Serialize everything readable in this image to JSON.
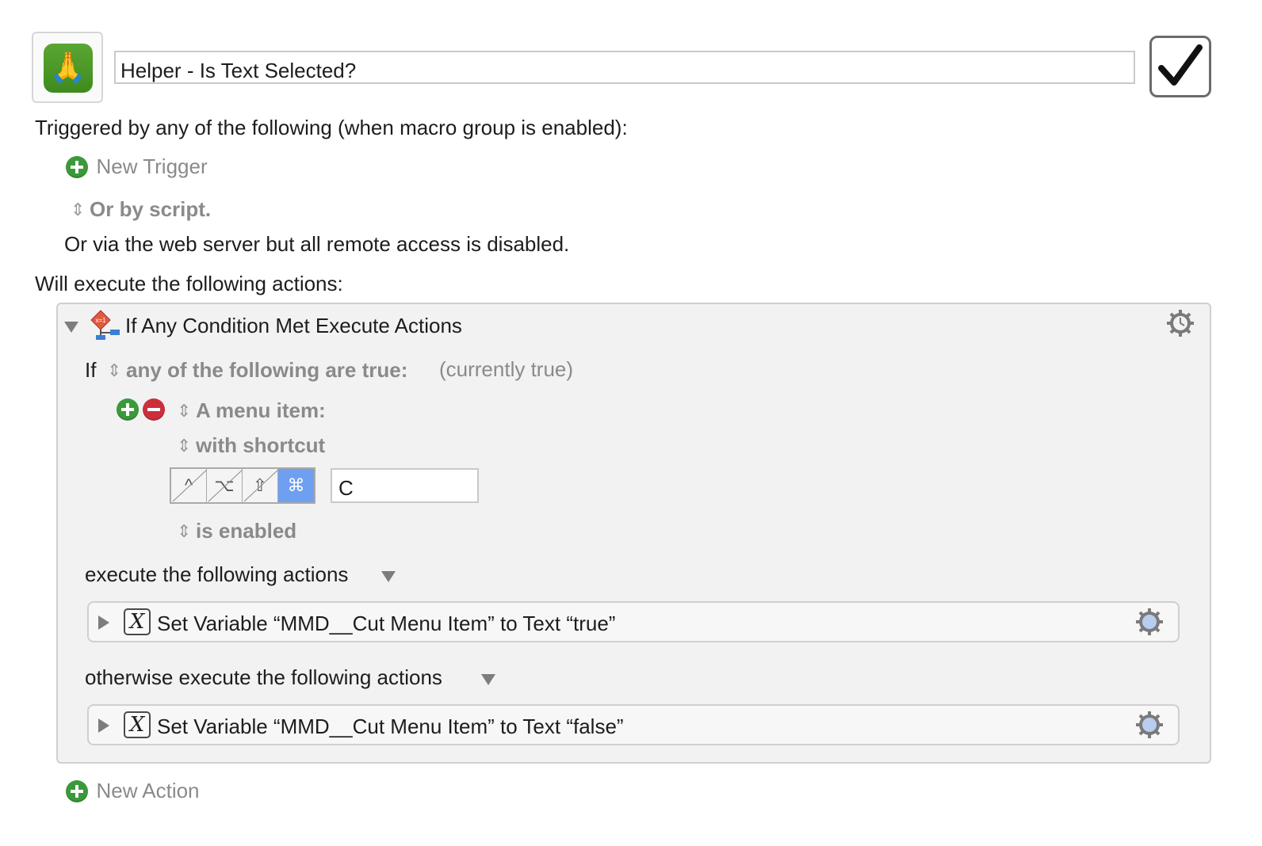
{
  "macro": {
    "icon": "praying-hands-emoji",
    "name": "Helper - Is Text Selected?",
    "enabled": true
  },
  "triggers": {
    "heading": "Triggered by any of the following (when macro group is enabled):",
    "new_trigger_label": "New Trigger",
    "or_by_script_label": "Or by script.",
    "web_server_text": "Or via the web server but all remote access is disabled."
  },
  "actions": {
    "heading": "Will execute the following actions:",
    "if_action": {
      "title": "If Any Condition Met Execute Actions",
      "if_label": "If",
      "condition_mode": "any of the following are true:",
      "status": "(currently true)",
      "condition": {
        "type_label": "A menu item:",
        "match_label": "with shortcut",
        "modifiers": [
          {
            "name": "control",
            "glyph": "^",
            "on": false
          },
          {
            "name": "option",
            "glyph": "⌥",
            "on": false
          },
          {
            "name": "shift",
            "glyph": "⇧",
            "on": false
          },
          {
            "name": "command",
            "glyph": "⌘",
            "on": true
          }
        ],
        "shortcut_key": "C",
        "state_label": "is enabled"
      },
      "then_label": "execute the following actions",
      "then_action": "Set Variable “MMD__Cut Menu Item” to Text “true”",
      "else_label": "otherwise execute the following actions",
      "else_action": "Set Variable “MMD__Cut Menu Item” to Text “false”"
    },
    "new_action_label": "New Action"
  },
  "colors": {
    "add_green": "#3a9a3a",
    "remove_red": "#cc2f3b",
    "modifier_on_blue": "#6f9ff0"
  }
}
